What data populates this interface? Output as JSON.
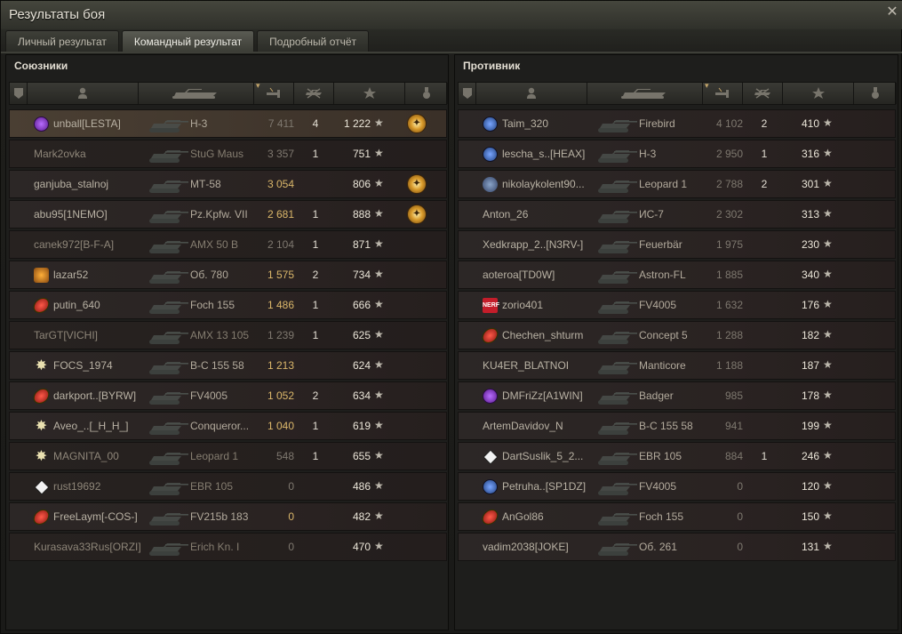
{
  "window": {
    "title": "Результаты боя",
    "close_icon": "close-icon"
  },
  "tabs": [
    {
      "label": "Личный результат",
      "active": false
    },
    {
      "label": "Командный результат",
      "active": true
    },
    {
      "label": "Подробный отчёт",
      "active": false
    }
  ],
  "columns": {
    "icons": [
      "squad-icon",
      "player-icon",
      "tank-icon",
      "damage-icon",
      "frags-icon",
      "experience-icon",
      "medal-icon"
    ],
    "sort": "damage, descending"
  },
  "allies": {
    "title": "Союзники",
    "players": [
      {
        "badge": "purple",
        "name": "unball[LESTA]",
        "vehicle": "Н-3",
        "damage": "7 411",
        "damage_gray": true,
        "kills": "4",
        "xp": "1 222",
        "medal": true,
        "self": true
      },
      {
        "badge": "",
        "name": "Mark2ovka",
        "vehicle": "StuG Maus",
        "damage": "3 357",
        "damage_gray": true,
        "kills": "1",
        "xp": "751",
        "medal": false,
        "dead": true
      },
      {
        "badge": "",
        "name": "ganjuba_stalnoj",
        "vehicle": "МТ-58",
        "damage": "3 054",
        "damage_gray": false,
        "kills": "",
        "xp": "806",
        "medal": true
      },
      {
        "badge": "",
        "name": "abu95[1NEMO]",
        "vehicle": "Pz.Kpfw. VII",
        "damage": "2 681",
        "damage_gray": false,
        "kills": "1",
        "xp": "888",
        "medal": true
      },
      {
        "badge": "",
        "name": "canek972[B-F-A]",
        "vehicle": "AMX 50 B",
        "damage": "2 104",
        "damage_gray": true,
        "kills": "1",
        "xp": "871",
        "medal": false,
        "dead": true
      },
      {
        "badge": "tiger",
        "name": "lazar52",
        "vehicle": "Об. 780",
        "damage": "1 575",
        "damage_gray": false,
        "kills": "2",
        "xp": "734",
        "medal": false
      },
      {
        "badge": "red",
        "name": "putin_640",
        "vehicle": "Foch 155",
        "damage": "1 486",
        "damage_gray": false,
        "kills": "1",
        "xp": "666",
        "medal": false
      },
      {
        "badge": "",
        "name": "TarGT[VICHI]",
        "vehicle": "AMX 13 105",
        "damage": "1 239",
        "damage_gray": true,
        "kills": "1",
        "xp": "625",
        "medal": false,
        "dead": true
      },
      {
        "badge": "star",
        "name": "FOCS_1974",
        "vehicle": "В-С 155 58",
        "damage": "1 213",
        "damage_gray": false,
        "kills": "",
        "xp": "624",
        "medal": false
      },
      {
        "badge": "red",
        "name": "darkport..[BYRW]",
        "vehicle": "FV4005",
        "damage": "1 052",
        "damage_gray": false,
        "kills": "2",
        "xp": "634",
        "medal": false
      },
      {
        "badge": "star",
        "name": "Aveo_..[_H_H_]",
        "vehicle": "Conqueror...",
        "damage": "1 040",
        "damage_gray": false,
        "kills": "1",
        "xp": "619",
        "medal": false
      },
      {
        "badge": "star",
        "name": "MAGNITA_00",
        "vehicle": "Leopard 1",
        "damage": "548",
        "damage_gray": true,
        "kills": "1",
        "xp": "655",
        "medal": false,
        "dead": true
      },
      {
        "badge": "diamond",
        "name": "rust19692",
        "vehicle": "EBR 105",
        "damage": "0",
        "damage_gray": true,
        "kills": "",
        "xp": "486",
        "medal": false,
        "dead": true
      },
      {
        "badge": "red",
        "name": "FreeLaym[-COS-]",
        "vehicle": "FV215b 183",
        "damage": "0",
        "damage_gray": false,
        "kills": "",
        "xp": "482",
        "medal": false
      },
      {
        "badge": "",
        "name": "Kurasava33Rus[ORZI]",
        "vehicle": "Erich Kn. I",
        "damage": "0",
        "damage_gray": true,
        "kills": "",
        "xp": "470",
        "medal": false,
        "dead": true
      }
    ]
  },
  "enemies": {
    "title": "Противник",
    "players": [
      {
        "badge": "blue",
        "name": "Taim_320",
        "vehicle": "Firebird",
        "damage": "4 102",
        "damage_gray": true,
        "kills": "2",
        "xp": "410",
        "medal": false
      },
      {
        "badge": "blue",
        "name": "lescha_s..[HEAX]",
        "vehicle": "Н-3",
        "damage": "2 950",
        "damage_gray": true,
        "kills": "1",
        "xp": "316",
        "medal": false
      },
      {
        "badge": "plain",
        "name": "nikolaykolent90...",
        "vehicle": "Leopard 1",
        "damage": "2 788",
        "damage_gray": true,
        "kills": "2",
        "xp": "301",
        "medal": false
      },
      {
        "badge": "",
        "name": "Anton_26",
        "vehicle": "ИС-7",
        "damage": "2 302",
        "damage_gray": true,
        "kills": "",
        "xp": "313",
        "medal": false
      },
      {
        "badge": "",
        "name": "Xedkrapp_2..[N3RV-]",
        "vehicle": "Feuerbär",
        "damage": "1 975",
        "damage_gray": true,
        "kills": "",
        "xp": "230",
        "medal": false
      },
      {
        "badge": "",
        "name": "aoteroa[TD0W]",
        "vehicle": "Astron-FL",
        "damage": "1 885",
        "damage_gray": true,
        "kills": "",
        "xp": "340",
        "medal": false
      },
      {
        "badge": "nerf",
        "name": "zorio401",
        "vehicle": "FV4005",
        "damage": "1 632",
        "damage_gray": true,
        "kills": "",
        "xp": "176",
        "medal": false
      },
      {
        "badge": "red",
        "name": "Chechen_shturm",
        "vehicle": "Concept 5",
        "damage": "1 288",
        "damage_gray": true,
        "kills": "",
        "xp": "182",
        "medal": false
      },
      {
        "badge": "",
        "name": "KU4ER_BLATNOI",
        "vehicle": "Manticore",
        "damage": "1 188",
        "damage_gray": true,
        "kills": "",
        "xp": "187",
        "medal": false
      },
      {
        "badge": "purple",
        "name": "DMFriZz[A1WIN]",
        "vehicle": "Badger",
        "damage": "985",
        "damage_gray": true,
        "kills": "",
        "xp": "178",
        "medal": false
      },
      {
        "badge": "",
        "name": "ArtemDavidov_N",
        "vehicle": "В-С 155 58",
        "damage": "941",
        "damage_gray": true,
        "kills": "",
        "xp": "199",
        "medal": false
      },
      {
        "badge": "diamond",
        "name": "DartSuslik_5_2...",
        "vehicle": "EBR 105",
        "damage": "884",
        "damage_gray": true,
        "kills": "1",
        "xp": "246",
        "medal": false
      },
      {
        "badge": "blue",
        "name": "Petruha..[SP1DZ]",
        "vehicle": "FV4005",
        "damage": "0",
        "damage_gray": true,
        "kills": "",
        "xp": "120",
        "medal": false
      },
      {
        "badge": "red",
        "name": "AnGol86",
        "vehicle": "Foch 155",
        "damage": "0",
        "damage_gray": true,
        "kills": "",
        "xp": "150",
        "medal": false
      },
      {
        "badge": "",
        "name": "vadim2038[JOKE]",
        "vehicle": "Об. 261",
        "damage": "0",
        "damage_gray": true,
        "kills": "",
        "xp": "131",
        "medal": false
      }
    ]
  }
}
